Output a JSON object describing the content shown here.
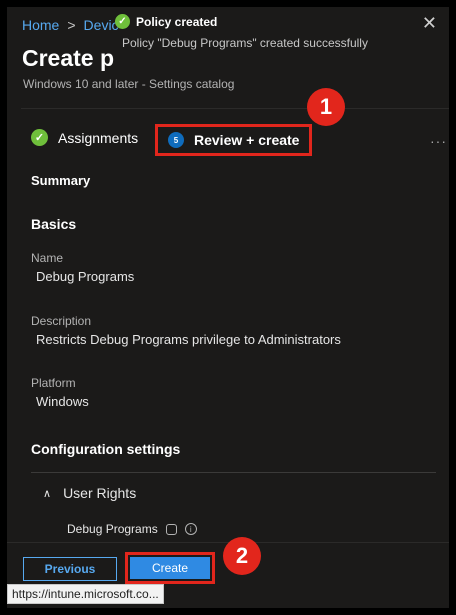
{
  "breadcrumb": {
    "home": "Home",
    "separator": ">",
    "devices": "Devic"
  },
  "page": {
    "title": "Create p",
    "subtitle": "Windows 10 and later - Settings catalog"
  },
  "toast": {
    "title": "Policy created",
    "message": "Policy \"Debug Programs\" created successfully",
    "icon": "check-circle-icon",
    "color": "#6fbf3b"
  },
  "close_glyph": "✕",
  "steps": {
    "assignments": {
      "label": "Assignments",
      "icon": "check-circle-icon"
    },
    "review": {
      "label": "Review + create",
      "number": "5"
    }
  },
  "more_glyph": "···",
  "callouts": {
    "one": "1",
    "two": "2",
    "color": "#e2261c"
  },
  "summary": {
    "heading": "Summary"
  },
  "basics": {
    "heading": "Basics",
    "name_label": "Name",
    "name_value": "Debug Programs",
    "description_label": "Description",
    "description_value": "Restricts Debug Programs privilege to Administrators",
    "platform_label": "Platform",
    "platform_value": "Windows"
  },
  "configuration": {
    "heading": "Configuration settings",
    "group": {
      "label": "User Rights",
      "icon": "chevron-up-icon"
    },
    "setting": {
      "label": "Debug Programs"
    }
  },
  "footer": {
    "previous_label": "Previous",
    "create_label": "Create"
  },
  "status_bar": {
    "url": "https://intune.microsoft.co..."
  },
  "colors": {
    "accent": "#57a9f0",
    "primary_button": "#2f8ae3",
    "background": "#1b1a19"
  }
}
